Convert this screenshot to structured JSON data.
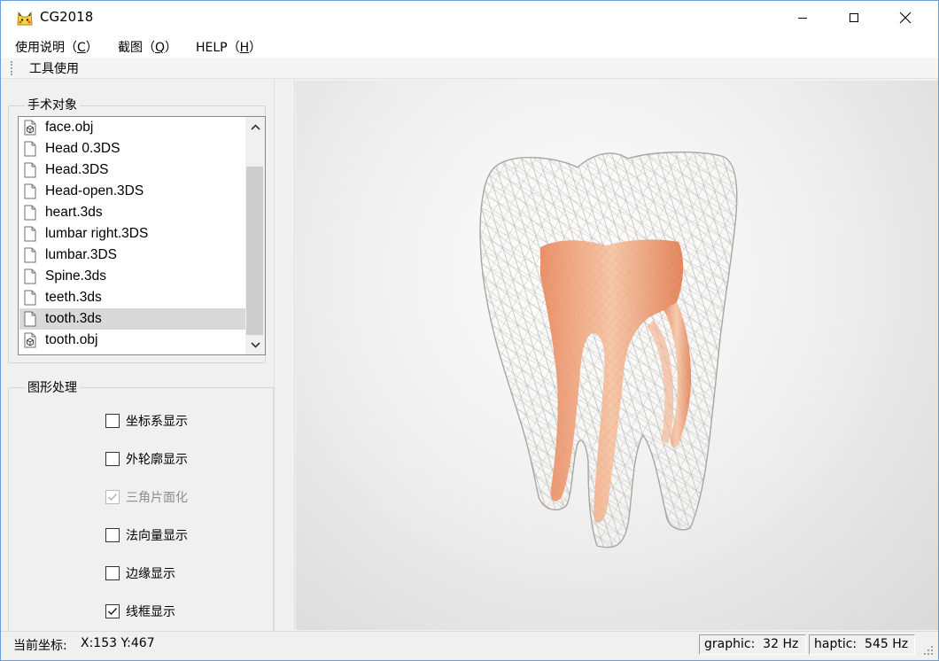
{
  "window": {
    "title": "CG2018",
    "icon": "pikachu-app-icon",
    "controls": {
      "minimize": "minimize-icon",
      "maximize": "maximize-icon",
      "close": "close-icon"
    }
  },
  "menu": [
    {
      "label": "使用说明（",
      "key": "C",
      "end": "）"
    },
    {
      "label": "截图（",
      "key": "Q",
      "end": "）"
    },
    {
      "label": "HELP（",
      "key": "H",
      "end": "）"
    }
  ],
  "toolbar": {
    "label": "工具使用"
  },
  "surgery_objects": {
    "title": "手术对象",
    "files": [
      {
        "name": "face.obj",
        "icon": "obj-file-icon"
      },
      {
        "name": "Head 0.3DS",
        "icon": "blank-file-icon"
      },
      {
        "name": "Head.3DS",
        "icon": "blank-file-icon"
      },
      {
        "name": "Head-open.3DS",
        "icon": "blank-file-icon"
      },
      {
        "name": "heart.3ds",
        "icon": "blank-file-icon"
      },
      {
        "name": "lumbar right.3DS",
        "icon": "blank-file-icon"
      },
      {
        "name": "lumbar.3DS",
        "icon": "blank-file-icon"
      },
      {
        "name": "Spine.3ds",
        "icon": "blank-file-icon"
      },
      {
        "name": "teeth.3ds",
        "icon": "blank-file-icon"
      },
      {
        "name": "tooth.3ds",
        "icon": "blank-file-icon",
        "selected": true
      },
      {
        "name": "tooth.obj",
        "icon": "obj-file-icon"
      }
    ]
  },
  "graphics_processing": {
    "title": "图形处理",
    "options": [
      {
        "label": "坐标系显示",
        "checked": false,
        "enabled": true
      },
      {
        "label": "外轮廓显示",
        "checked": false,
        "enabled": true
      },
      {
        "label": "三角片面化",
        "checked": true,
        "enabled": false
      },
      {
        "label": "法向量显示",
        "checked": false,
        "enabled": true
      },
      {
        "label": "边缘显示",
        "checked": false,
        "enabled": true
      },
      {
        "label": "线框显示",
        "checked": true,
        "enabled": true
      }
    ]
  },
  "viewport": {
    "model": "tooth-wireframe-model",
    "wire_color": "#b9b6b1",
    "pulp_color": "#e8875a"
  },
  "status": {
    "coord_label": "当前坐标:",
    "coord_value": "X:153 Y:467",
    "graphic": "graphic:  32 Hz",
    "haptic": "haptic:  545 Hz"
  },
  "colors": {
    "selection": "#d9d9d9",
    "window_border": "#6a9ed8"
  }
}
